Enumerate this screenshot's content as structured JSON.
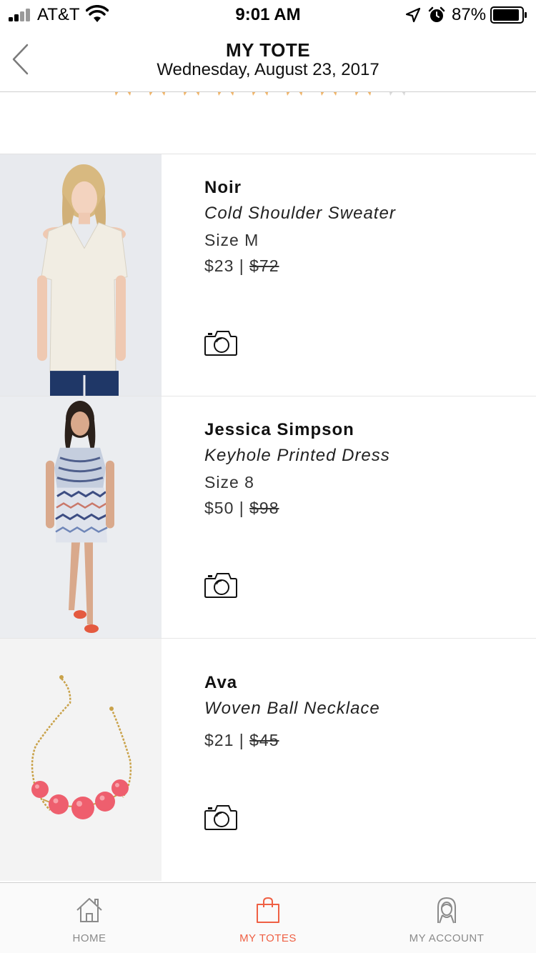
{
  "status_bar": {
    "carrier": "AT&T",
    "time": "9:01 AM",
    "battery": "87%",
    "icons": [
      "signal-icon",
      "wifi-icon",
      "location-icon",
      "alarm-icon",
      "battery-icon"
    ]
  },
  "header": {
    "title": "MY TOTE",
    "date": "Wednesday, August 23, 2017",
    "back_icon": "chevron-left-icon"
  },
  "rating": {
    "stars_shown": 9,
    "stars_filled": 8,
    "color_filled": "#f0b469",
    "color_empty": "#d9d9d9"
  },
  "items": [
    {
      "brand": "Noir",
      "product": "Cold Shoulder Sweater",
      "size": "Size M",
      "price": "$23",
      "separator": "|",
      "original_price": "$72",
      "image_icon": "sweater-photo",
      "camera_icon": "camera-icon"
    },
    {
      "brand": "Jessica Simpson",
      "product": "Keyhole Printed Dress",
      "size": "Size 8",
      "price": "$50",
      "separator": "|",
      "original_price": "$98",
      "image_icon": "dress-photo",
      "camera_icon": "camera-icon"
    },
    {
      "brand": "Ava",
      "product": "Woven Ball Necklace",
      "size": "",
      "price": "$21",
      "separator": "|",
      "original_price": "$45",
      "image_icon": "necklace-photo",
      "camera_icon": "camera-icon"
    }
  ],
  "tab_bar": {
    "tabs": [
      {
        "label": "HOME",
        "icon": "home-icon",
        "active": false
      },
      {
        "label": "MY TOTES",
        "icon": "bag-icon",
        "active": true
      },
      {
        "label": "MY ACCOUNT",
        "icon": "account-icon",
        "active": false
      }
    ]
  },
  "colors": {
    "accent": "#ef6044",
    "text": "#111111",
    "muted": "#8a8a8a",
    "divider": "#e6e6e6"
  }
}
